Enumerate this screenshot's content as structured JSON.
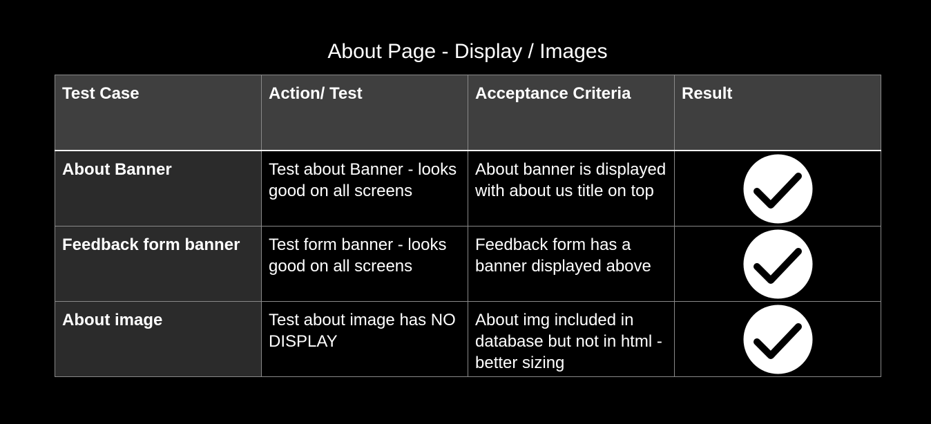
{
  "title": "About Page - Display / Images",
  "table": {
    "headers": [
      "Test Case",
      "Action/ Test",
      "Acceptance Criteria",
      "Result"
    ],
    "rows": [
      {
        "test_case": "About Banner",
        "action": "Test about Banner - looks good on all screens",
        "criteria": "About banner is displayed with about us title on top",
        "result_icon": "check-circle-icon"
      },
      {
        "test_case": "Feedback form banner",
        "action": "Test form banner - looks good on all screens",
        "criteria": "Feedback form has a banner displayed above",
        "result_icon": "check-circle-icon"
      },
      {
        "test_case": "About image",
        "action": "Test about image has NO DISPLAY",
        "criteria": "About img included in database but not in html -  better sizing",
        "result_icon": "check-circle-icon"
      }
    ]
  },
  "colors": {
    "background": "#000000",
    "header_fill": "#3f3f3f",
    "first_column_fill": "#2b2b2b",
    "grid_line": "#8a8a8a",
    "text": "#ffffff"
  }
}
